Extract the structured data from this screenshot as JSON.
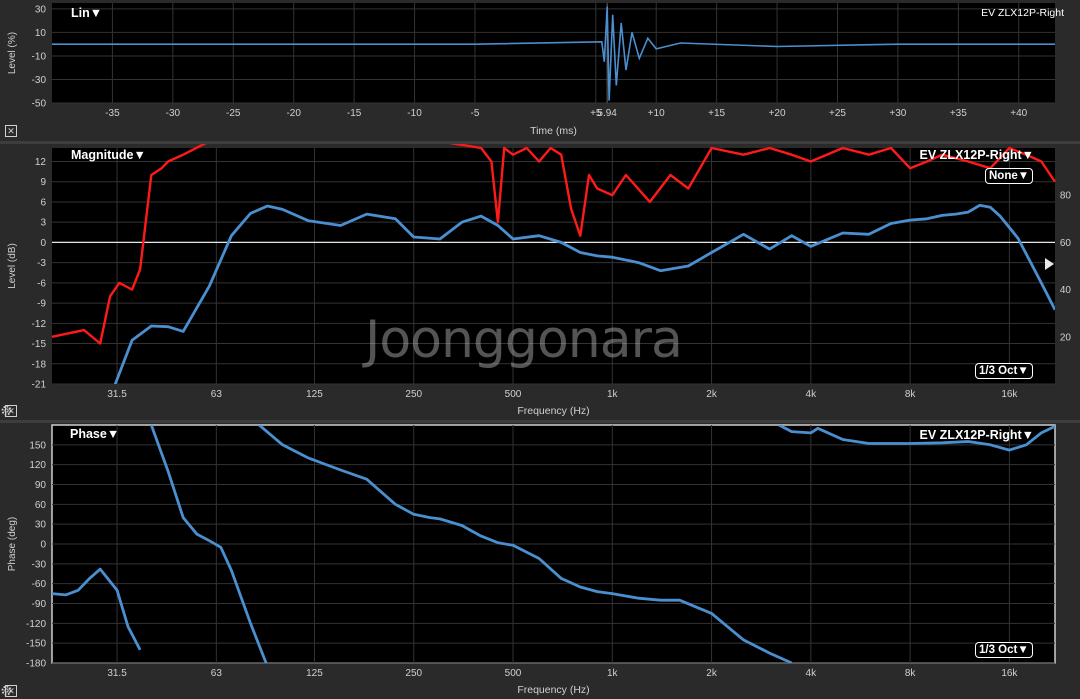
{
  "time_panel": {
    "scale_label": "Lin▼",
    "trace_name": "EV ZLX12P-Right",
    "xlabel": "Time (ms)",
    "ylabel": "Level (%)",
    "close_icon": "close-icon"
  },
  "magnitude_panel": {
    "title_label": "Magnitude▼",
    "trace_name": "EV ZLX12P-Right▼",
    "coherence_mode": "None▼",
    "smoothing": "1/3 Oct▼",
    "xlabel": "Frequency (Hz)",
    "ylabel": "Level (dB)",
    "close_icon": "close-icon",
    "gear_icon": "gear-icon"
  },
  "phase_panel": {
    "title_label": "Phase▼",
    "trace_name": "EV ZLX12P-Right▼",
    "smoothing": "1/3 Oct▼",
    "xlabel": "Frequency (Hz)",
    "ylabel": "Phase (deg)",
    "close_icon": "close-icon",
    "gear_icon": "gear-icon"
  },
  "watermark": "Joonggonara",
  "colors": {
    "trace_blue": "#4a8fd0",
    "coherence_red": "#ff1a1a",
    "plot_bg": "#000000",
    "grid": "#333333"
  },
  "chart_data": [
    {
      "type": "line",
      "title": "",
      "xlabel": "Time (ms)",
      "ylabel": "Level (%)",
      "xlim": [
        -40,
        43
      ],
      "ylim": [
        -50,
        35
      ],
      "x_ticks": [
        -35,
        -30,
        -25,
        -20,
        -15,
        -10,
        -5,
        5.94,
        5,
        10,
        15,
        20,
        25,
        30,
        35,
        40
      ],
      "x_tick_labels": [
        "-35",
        "-30",
        "-25",
        "-20",
        "-15",
        "-10",
        "-5",
        "5.94",
        "+5",
        "+10",
        "+15",
        "+20",
        "+25",
        "+30",
        "+35",
        "+40"
      ],
      "y_ticks": [
        30,
        10,
        -10,
        -30,
        -50
      ],
      "peak_time_ms": 5.94,
      "series": [
        {
          "name": "EV ZLX12P-Right",
          "x": [
            -40,
            -20,
            -5,
            5.5,
            5.7,
            5.94,
            6.1,
            6.4,
            6.7,
            7.1,
            7.5,
            8.0,
            8.6,
            9.3,
            10,
            12,
            20,
            30,
            43
          ],
          "y": [
            0,
            0,
            0,
            2,
            -15,
            32,
            -48,
            25,
            -35,
            18,
            -22,
            10,
            -12,
            5,
            -4,
            1,
            -2,
            0,
            0
          ]
        }
      ]
    },
    {
      "type": "line",
      "title": "",
      "xlabel": "Frequency (Hz)",
      "ylabel": "Level (dB)",
      "x_scale": "log",
      "xlim": [
        20,
        22000
      ],
      "ylim": [
        -21,
        14
      ],
      "x_tick_labels": [
        "31.5",
        "63",
        "125",
        "250",
        "500",
        "1k",
        "2k",
        "4k",
        "8k",
        "16k"
      ],
      "x_ticks": [
        31.5,
        63,
        125,
        250,
        500,
        1000,
        2000,
        4000,
        8000,
        16000
      ],
      "y_ticks": [
        12,
        9,
        6,
        3,
        0,
        -3,
        -6,
        -9,
        -12,
        -15,
        -18,
        -21
      ],
      "y2_ticks": [
        80,
        60,
        40,
        20
      ],
      "series": [
        {
          "name": "EV ZLX12P-Right",
          "x": [
            20,
            30,
            35,
            40,
            45,
            50,
            60,
            70,
            80,
            90,
            100,
            120,
            150,
            180,
            220,
            250,
            300,
            350,
            400,
            450,
            500,
            600,
            700,
            800,
            900,
            1000,
            1200,
            1400,
            1700,
            2000,
            2500,
            3000,
            3500,
            4000,
            5000,
            6000,
            7000,
            8000,
            9000,
            10000,
            11000,
            12000,
            13000,
            14000,
            15000,
            17000,
            20000,
            22000
          ],
          "y": [
            -32,
            -23,
            -14.5,
            -12.4,
            -12.5,
            -13.2,
            -6.5,
            1,
            4.3,
            5.4,
            4.9,
            3.2,
            2.5,
            4.2,
            3.5,
            0.8,
            0.5,
            3,
            3.9,
            2.5,
            0.5,
            1,
            0,
            -1.5,
            -2,
            -2.2,
            -3,
            -4.2,
            -3.5,
            -1.5,
            1.2,
            -1,
            1,
            -0.6,
            1.4,
            1.2,
            2.8,
            3.3,
            3.5,
            4,
            4.2,
            4.5,
            5.5,
            5.2,
            3.9,
            0.6,
            -6,
            -10
          ]
        },
        {
          "name": "coherence",
          "axis": "right",
          "x": [
            20,
            25,
            28,
            30,
            32,
            35,
            37,
            40,
            43,
            45,
            50,
            60,
            80,
            150,
            300,
            400,
            430,
            450,
            470,
            500,
            550,
            600,
            650,
            700,
            750,
            800,
            850,
            900,
            1000,
            1100,
            1300,
            1500,
            1700,
            2000,
            2500,
            3000,
            3500,
            4000,
            5000,
            6000,
            7000,
            8000,
            9000,
            10000,
            12000,
            14000,
            16000,
            18000,
            20000,
            22000
          ],
          "y": [
            -14,
            -13,
            -15,
            -8,
            -6,
            -7,
            -4,
            10,
            11,
            12,
            13,
            15,
            15,
            15,
            15,
            14,
            12,
            3,
            14,
            13,
            14,
            12,
            14,
            13,
            5,
            1,
            10,
            8,
            7,
            10,
            6,
            10,
            8,
            14,
            13,
            14,
            13,
            12,
            14,
            13,
            14,
            11,
            12,
            13,
            12,
            11,
            14,
            13,
            12,
            9
          ]
        }
      ]
    },
    {
      "type": "line",
      "title": "",
      "xlabel": "Frequency (Hz)",
      "ylabel": "Phase (deg)",
      "x_scale": "log",
      "xlim": [
        20,
        22000
      ],
      "ylim": [
        -180,
        180
      ],
      "x_tick_labels": [
        "31.5",
        "63",
        "125",
        "250",
        "500",
        "1k",
        "2k",
        "4k",
        "8k",
        "16k"
      ],
      "x_ticks": [
        31.5,
        63,
        125,
        250,
        500,
        1000,
        2000,
        4000,
        8000,
        16000
      ],
      "y_ticks": [
        150,
        120,
        90,
        60,
        30,
        0,
        -30,
        -60,
        -90,
        -120,
        -150,
        -180
      ],
      "series": [
        {
          "name": "EV ZLX12P-Right",
          "segments": [
            {
              "x": [
                20,
                22,
                24,
                26,
                28,
                31.5,
                34,
                37
              ],
              "y": [
                -75,
                -77,
                -70,
                -52,
                -38,
                -70,
                -125,
                -160
              ]
            },
            {
              "x": [
                40,
                45,
                50,
                55,
                60,
                65,
                70,
                80,
                90
              ],
              "y": [
                180,
                110,
                40,
                15,
                5,
                -5,
                -40,
                -120,
                -185
              ]
            },
            {
              "x": [
                85,
                100,
                120,
                150,
                180,
                220,
                250,
                280,
                300,
                350,
                400,
                450,
                500,
                600,
                700,
                800,
                900,
                1000,
                1200,
                1400,
                1600,
                2000,
                2500,
                3000,
                3500
              ],
              "y": [
                180,
                150,
                130,
                112,
                98,
                60,
                45,
                40,
                38,
                28,
                12,
                2,
                -2,
                -22,
                -52,
                -65,
                -72,
                -75,
                -82,
                -85,
                -85,
                -105,
                -145,
                -165,
                -180
              ]
            },
            {
              "x": [
                3200,
                3500,
                4000,
                4200,
                5000,
                6000,
                8000,
                10000,
                12000,
                14000,
                16000,
                18000,
                20000,
                22000
              ],
              "y": [
                180,
                170,
                168,
                175,
                158,
                152,
                152,
                153,
                155,
                150,
                142,
                150,
                168,
                178
              ]
            }
          ]
        }
      ]
    }
  ]
}
